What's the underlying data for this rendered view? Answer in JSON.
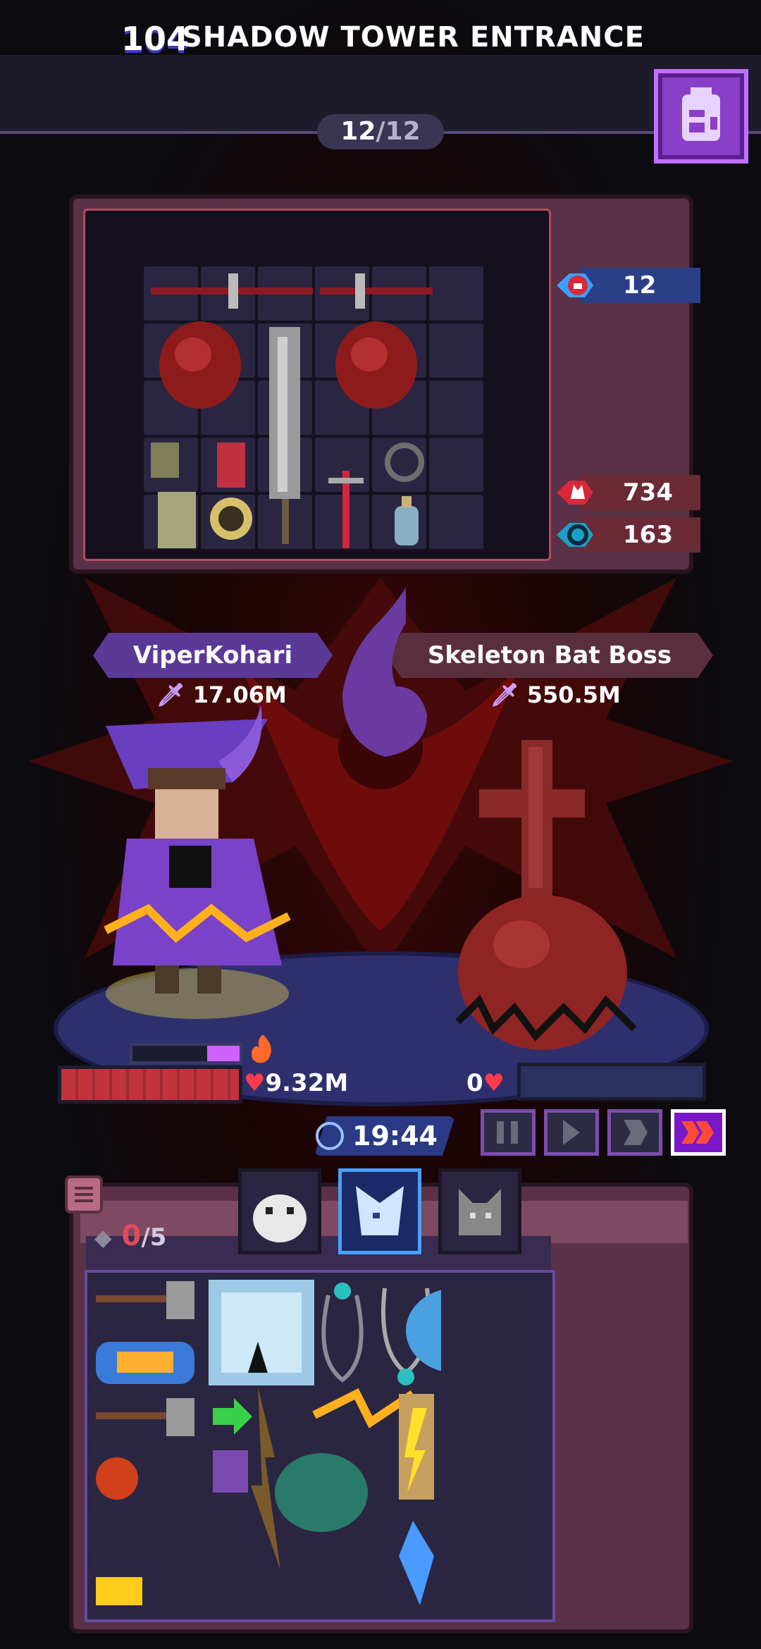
{
  "header": {
    "level": "104",
    "title": "SHADOW TOWER ENTRANCE",
    "progress_current": "12",
    "progress_total": "/12"
  },
  "enemy_stats": {
    "items_count": "12",
    "attack": "734",
    "defense": "163"
  },
  "hero": {
    "name": "ViperKohari",
    "power": "17.06M",
    "hp": "9.32M",
    "hp_fraction": 1.0,
    "energy_fraction": 0.3
  },
  "boss": {
    "name": "Skeleton Bat Boss",
    "power": "550.5M",
    "hp": "0",
    "hp_fraction": 0.0
  },
  "battle": {
    "timer": "19:44",
    "speed_buttons": [
      "pause-icon",
      "play-icon",
      "fast-forward-icon",
      "double-fast-forward-icon"
    ],
    "active_speed": "double-fast-forward-icon"
  },
  "player_inventory": {
    "slots_used": "0",
    "slots_max": "/5"
  },
  "pets": [
    "pet-bear-icon",
    "pet-wolf-icon",
    "pet-cat-icon"
  ],
  "colors": {
    "accent_purple": "#8a3fc8",
    "hp_red": "#c0343e",
    "panel_maroon": "#5a3146"
  }
}
